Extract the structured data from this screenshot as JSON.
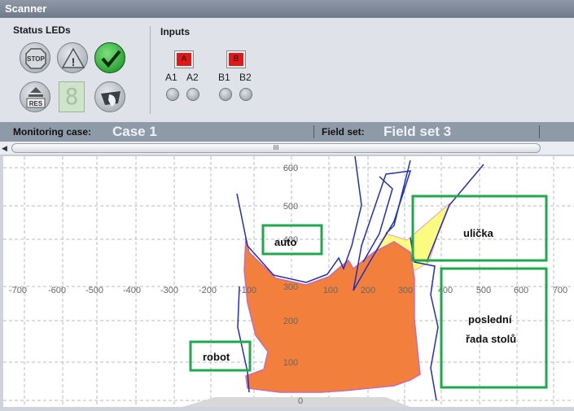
{
  "window": {
    "title": "Scanner"
  },
  "status_leds": {
    "label": "Status LEDs",
    "stop_icon_text": "STOP",
    "warning_icon_text": "!",
    "res_icon_text": "RES",
    "segment_text": "8"
  },
  "inputs": {
    "label": "Inputs",
    "flag_a": "A",
    "flag_b": "B",
    "a1": "A1",
    "a2": "A2",
    "b1": "B1",
    "b2": "B2"
  },
  "status_bar": {
    "monitoring_label": "Monitoring case:",
    "monitoring_value": "Case 1",
    "field_set_label": "Field set:",
    "field_set_value": "Field set 3"
  },
  "scrollbar": {
    "left_arrow": "◀",
    "thumb_grip": "III"
  },
  "plot": {
    "x_ticks": [
      "-700",
      "-600",
      "-500",
      "-400",
      "-300",
      "-200",
      "-100",
      "100",
      "200",
      "300",
      "400",
      "500",
      "600",
      "700"
    ],
    "y_ticks": [
      "600",
      "500",
      "400",
      "300",
      "200",
      "100",
      "0"
    ],
    "annotations": {
      "auto": "auto",
      "ulicka": "ulička",
      "posledni_1": "poslední",
      "posledni_2": "řada stolů",
      "robot": "robot"
    },
    "colors": {
      "field_orange": "#f2803c",
      "field_yellow": "#fbfb80",
      "contour_blue": "#1f2fb8",
      "annotation_green": "#1fa84c"
    }
  }
}
